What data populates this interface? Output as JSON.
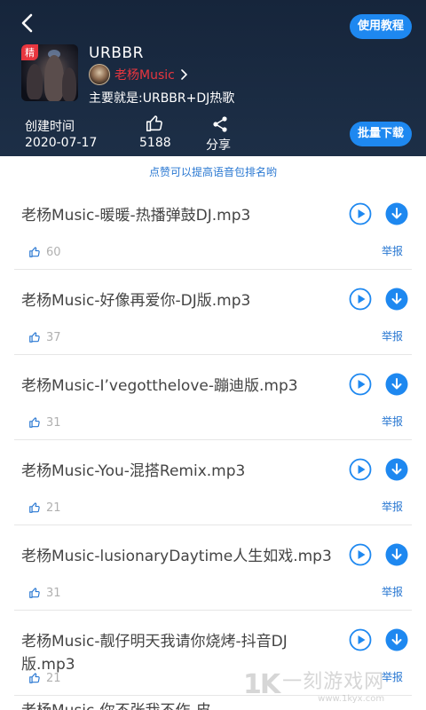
{
  "header": {
    "tutorial_label": "使用教程",
    "batch_download_label": "批量下载",
    "cover_badge": "精",
    "title": "URBBR",
    "author": "老杨Music",
    "description": "主要就是:URBBR+DJ热歌",
    "created_label": "创建时间",
    "created_value": "2020-07-17",
    "likes_value": "5188",
    "share_label": "分享"
  },
  "hint": "点赞可以提高语音包排名哟",
  "report_label": "举报",
  "items": [
    {
      "name": "老杨Music-暖暖-热播弹鼓DJ.mp3",
      "likes": "60"
    },
    {
      "name": "老杨Music-好像再爱你-DJ版.mp3",
      "likes": "37"
    },
    {
      "name": "老杨Music-I’vegotthelove-蹦迪版.mp3",
      "likes": "31"
    },
    {
      "name": "老杨Music-You-混搭Remix.mp3",
      "likes": "21"
    },
    {
      "name": "老杨Music-lusionaryDaytime人生如戏.mp3",
      "likes": "31"
    },
    {
      "name": "老杨Music-靓仔明天我请你烧烤-抖音DJ版.mp3",
      "likes": "21"
    }
  ],
  "partial_item": "老杨Music-你不张我不作-皮...",
  "watermark": {
    "logo": "1K",
    "text": "一刻游戏网",
    "url": "www.1kyx.com"
  },
  "colors": {
    "header_bg": "#16253b",
    "accent": "#1e88f0",
    "author": "#e8363f"
  }
}
